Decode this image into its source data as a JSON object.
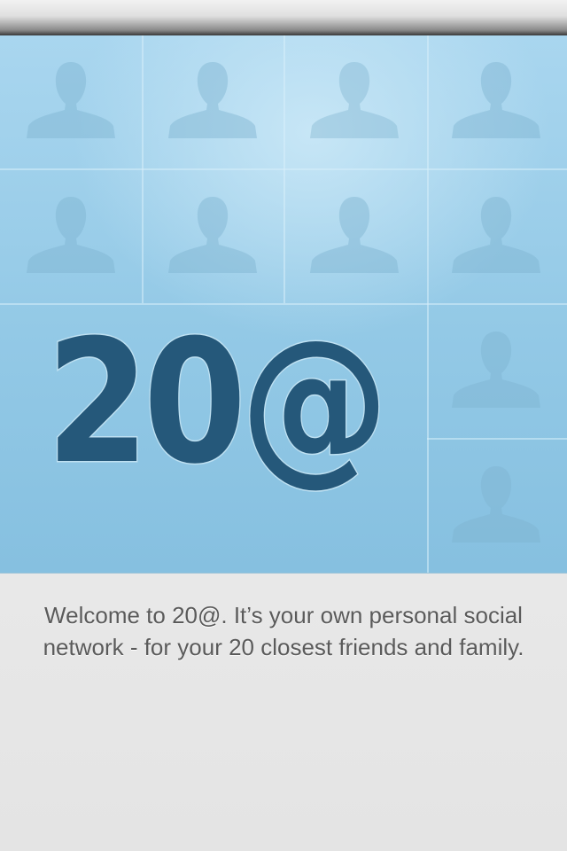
{
  "logo": {
    "text": "20@",
    "color": "#25587a",
    "outline_color": "#bfe1f2"
  },
  "hero": {
    "background_color": "#93c9e6",
    "placeholder_icon": "person-silhouette-icon"
  },
  "welcome": {
    "text": "Welcome to 20@. It’s your own personal social network - for your 20 closest friends and family."
  },
  "colors": {
    "body_text": "#5a5a5a",
    "page_background": "#ececec"
  }
}
